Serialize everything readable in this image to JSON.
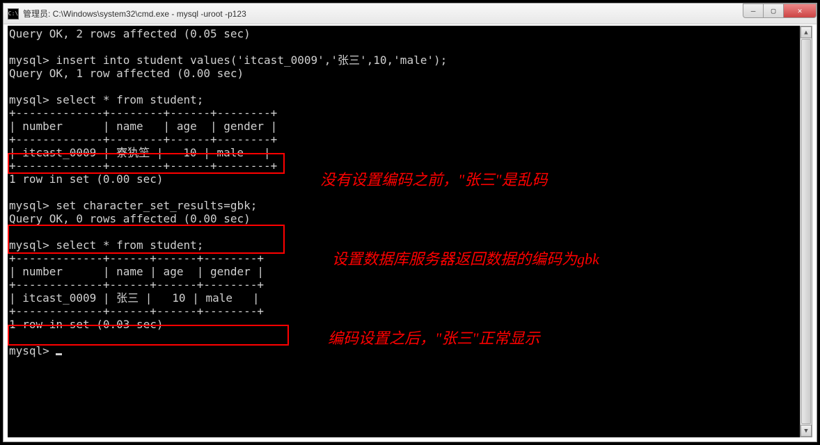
{
  "window": {
    "title": "管理员: C:\\Windows\\system32\\cmd.exe - mysql  -uroot -p123",
    "icon_label": "C:\\"
  },
  "controls": {
    "minimize": "—",
    "maximize": "▢",
    "close": "✕"
  },
  "terminal": {
    "lines": [
      "Query OK, 2 rows affected (0.05 sec)",
      "",
      "mysql> insert into student values('itcast_0009','张三',10,'male');",
      "Query OK, 1 row affected (0.00 sec)",
      "",
      "mysql> select * from student;",
      "+-------------+--------+------+--------+",
      "| number      | name   | age  | gender |",
      "+-------------+--------+------+--------+",
      "| itcast_0009 | 寮犱笁 |   10 | male   |",
      "+-------------+--------+------+--------+",
      "1 row in set (0.00 sec)",
      "",
      "mysql> set character_set_results=gbk;",
      "Query OK, 0 rows affected (0.00 sec)",
      "",
      "mysql> select * from student;",
      "+-------------+------+------+--------+",
      "| number      | name | age  | gender |",
      "+-------------+------+------+--------+",
      "| itcast_0009 | 张三 |   10 | male   |",
      "+-------------+------+------+--------+",
      "1 row in set (0.03 sec)",
      "",
      "mysql> "
    ]
  },
  "annotations": {
    "a1": "没有设置编码之前，\"张三\"是乱码",
    "a2": "设置数据库服务器返回数据的编码为gbk",
    "a3": "编码设置之后，\"张三\"正常显示"
  },
  "scrollbar": {
    "up": "▲",
    "down": "▼"
  }
}
